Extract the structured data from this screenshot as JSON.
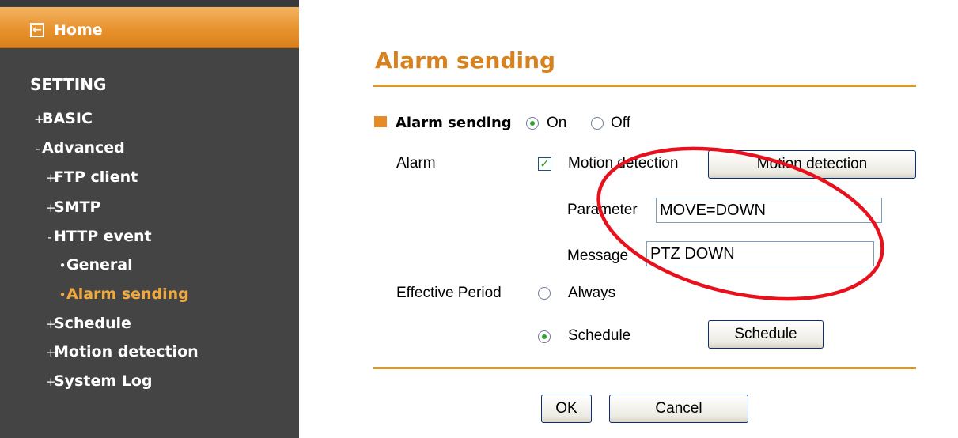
{
  "sidebar": {
    "home": "Home",
    "setting": "SETTING",
    "items": [
      {
        "marker": "+",
        "label": "BASIC"
      },
      {
        "marker": "-",
        "label": "Advanced"
      },
      {
        "marker": "+",
        "label": "FTP client"
      },
      {
        "marker": "+",
        "label": "SMTP"
      },
      {
        "marker": "-",
        "label": "HTTP event"
      },
      {
        "marker": "•",
        "label": "General"
      },
      {
        "marker": "•",
        "label": "Alarm sending"
      },
      {
        "marker": "+",
        "label": "Schedule"
      },
      {
        "marker": "+",
        "label": "Motion detection"
      },
      {
        "marker": "+",
        "label": "System Log"
      }
    ]
  },
  "page": {
    "title": "Alarm sending"
  },
  "form": {
    "alarm_sending_label": "Alarm sending",
    "on_label": "On",
    "off_label": "Off",
    "alarm_sending_value": "On",
    "alarm_label": "Alarm",
    "motion_checkbox_label": "Motion detection",
    "motion_checked": true,
    "motion_button": "Motion detection",
    "parameter_label": "Parameter",
    "parameter_value": "MOVE=DOWN",
    "message_label": "Message",
    "message_value": "PTZ DOWN",
    "effective_period_label": "Effective Period",
    "always_label": "Always",
    "schedule_label": "Schedule",
    "effective_period_value": "Schedule",
    "schedule_button": "Schedule"
  },
  "footer": {
    "ok": "OK",
    "cancel": "Cancel"
  },
  "colors": {
    "accent": "#d8821f",
    "sidebar_bg": "#444444",
    "active_nav": "#f0a840",
    "annotation": "#e8101c"
  }
}
